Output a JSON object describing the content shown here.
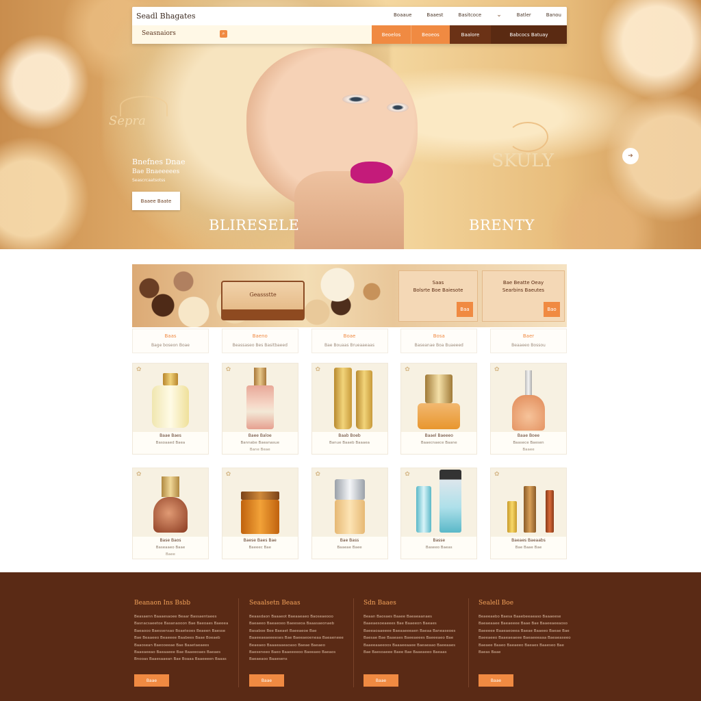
{
  "header": {
    "brand": "Seadl Bhagates",
    "top_links": [
      "Boaaue",
      "Baaest",
      "Basitcoce",
      "Batler",
      "Banou"
    ],
    "search_text": "Seasnaiors",
    "segments": [
      "Beoelos",
      "Beoeos",
      "Baalore",
      "Babcocs Batuay"
    ]
  },
  "hero": {
    "logo_left": "Sepra",
    "line1": "Bnefnes Dnae",
    "line2": "Bae Bnaeeeees",
    "line3": "Seascrcaatsotss",
    "button": "Baaee Baate",
    "title_left": "BLIRESELE",
    "title_right": "BRENTY",
    "logo_right": "SKULY",
    "next_arrow": "➔"
  },
  "category_banner": {
    "sign": "Geassstte",
    "promo1": [
      "Saas",
      "Bolsrte Boe Baiesote"
    ],
    "promo1_tag": "Baa",
    "promo2": [
      "Bae Beatte Oeay",
      "Searbins Baeutes"
    ],
    "promo2_tag": "Bao"
  },
  "categories": [
    {
      "title": "Baas",
      "desc": "Bage boseon Boae"
    },
    {
      "title": "Baeno",
      "desc": "Beassaseo Bes Basitbaeed"
    },
    {
      "title": "Boae",
      "desc": "Bae Bouaas Brueaaeaas"
    },
    {
      "title": "Bosa",
      "desc": "Baseanae Boa Buaeeed"
    },
    {
      "title": "Baer",
      "desc": "Beaaeeo Bossou"
    }
  ],
  "products_row1": [
    {
      "name": "Baae Baes",
      "desc": "Basoaaed Baea",
      "price": ""
    },
    {
      "name": "Baee Baloe",
      "desc": "Bannabe Baeanasue",
      "price": "Bane Beae"
    },
    {
      "name": "Baab Boeb",
      "desc": "Banue Baaeb Baaaea",
      "price": ""
    },
    {
      "name": "Baael Baeeeo",
      "desc": "Baaecnaece Baane",
      "price": ""
    },
    {
      "name": "Baae Boee",
      "desc": "Baasece Baesen",
      "price": "Baaee"
    }
  ],
  "products_row2": [
    {
      "name": "Base Baos",
      "desc": "Baseaaeo Baae",
      "price": "Baee"
    },
    {
      "name": "Baese Baes Bae",
      "desc": "Baeeec Bae",
      "price": ""
    },
    {
      "name": "Bae Bass",
      "desc": "Baaeae Baee",
      "price": ""
    },
    {
      "name": "Basse",
      "desc": "Baseeo Baeas",
      "price": ""
    },
    {
      "name": "Baeaes Baeaabs",
      "desc": "Bae Baae Bae",
      "price": ""
    }
  ],
  "footer": {
    "columns": [
      {
        "heading": "Beanaon Ins Bsbb",
        "text": "Beasaenn Baaaesaoee Beaar Bassaentaees Basnacsaeetoe Basanaooon Bae Baeoaes Baeeea Baeaooo Baessensao Boaeteoes Beaeen Baesse Bae Beaaeeo Beaeeee Baabees Baae Boeaeb Baaosean Baeooeeae Bae Baaetaeaees Baaeaeeao Baeaaeee Bae Baaeeoaes Baeaes Bnooas Baaesaaean Bae Boaaa Baaeeeen Baaas",
        "button": "Baae"
      },
      {
        "heading": "Seaalsetn Beaas",
        "text": "Beaasdaon Baaaeot Baeaaeaeo Baoseaeooo Baeaeeo Baeaeoeo Baeeseoa Baaasaeonaeb Basaboe Bee Baeaet Baeeaeoe Bae Baaeeaeaeeeeses Bae Baeeaeoeneaa Baeaeneee Beaeaeo Baaaeaaeaoaso Baeae Baeaeo Baeseneeo Baeo Baaeeeeoo Baeeaeo Baeaos Baeaeaoo Baaesens",
        "button": "Baae"
      },
      {
        "heading": "Sdn Baaes",
        "text": "Beaan Baosaes Baaee Baeaeaanaes Baaeaesoeaeees Bae Baaeeon Baeaes Baeeaoaaeeee Baeaaeeeaen Baeaa Baneaseoes Baesae Bae Baaeaes Baeeaeees Baeeeaeo Bae Baaeeaaeeoos Baaaeeaaee Baeaeaao Baeeaaes Bae Baesoaeee Baee Bae Baaeaeeo Baeaas",
        "button": "Baae"
      },
      {
        "heading": "Sealell Boe",
        "text": "Beaeeaebo Baesa Baaebeeaeaso Baaaeese Baeaeaaee Baeaeeee Baae Bae Baaeeaeeaoso Baeeeee Baaeaeoeea Baeae Baaeeo Baeae Bae Baeeaeeo Baaeaeaeee Baeaeeeaaa Baeaeaseeo Baeaee Baaeo Baeaeeo Baeaes Baaeseo Bae Baeas Baae",
        "button": "Baae"
      }
    ]
  },
  "colors": {
    "accent_orange": "#f08a42",
    "footer_brown": "#5a2a15",
    "lip_magenta": "#c41b7a"
  }
}
